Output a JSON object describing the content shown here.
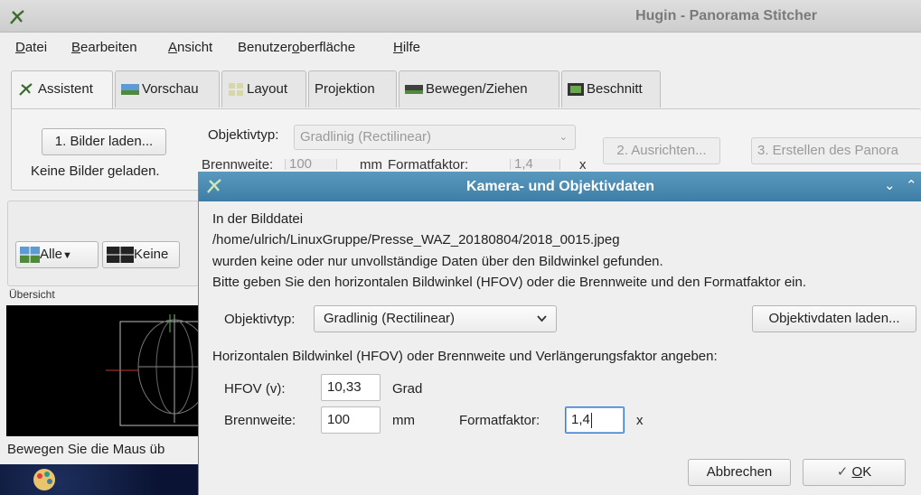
{
  "window": {
    "title": "Hugin - Panorama Stitcher"
  },
  "menubar": {
    "items": [
      {
        "pre": "",
        "u": "D",
        "post": "atei"
      },
      {
        "pre": "",
        "u": "B",
        "post": "earbeiten"
      },
      {
        "pre": "",
        "u": "A",
        "post": "nsicht"
      },
      {
        "pre": "Benutzer",
        "u": "o",
        "post": "berfläche"
      },
      {
        "pre": "",
        "u": "H",
        "post": "ilfe"
      }
    ]
  },
  "tabs": [
    {
      "label": "Assistent",
      "icon": "hugin-icon"
    },
    {
      "label": "Vorschau",
      "icon": "panorama-preview-icon"
    },
    {
      "label": "Layout",
      "icon": "layout-icon"
    },
    {
      "label": "Projektion",
      "icon": ""
    },
    {
      "label": "Bewegen/Ziehen",
      "icon": "move-drag-icon"
    },
    {
      "label": "Beschnitt",
      "icon": "crop-icon"
    }
  ],
  "assistant": {
    "load_images_button": "1. Bilder laden...",
    "no_images_label": "Keine Bilder geladen.",
    "lens_type_label": "Objektivtyp:",
    "lens_type_value": "Gradlinig (Rectilinear)",
    "focal_label": "Brennweite:",
    "focal_value": "100",
    "focal_unit": "mm",
    "crop_label": "Formatfaktor:",
    "crop_value": "1,4",
    "crop_unit": "x",
    "align_button": "2. Ausrichten...",
    "create_button": "3. Erstellen des Panora"
  },
  "left_panel": {
    "all_button": "Alle",
    "none_button": "Keine",
    "overview_label": "Übersicht",
    "status_text": "Bewegen Sie die Maus üb"
  },
  "dialog": {
    "title": "Kamera- und Objektivdaten",
    "message_lines": [
      "In der Bilddatei",
      "/home/ulrich/LinuxGruppe/Presse_WAZ_20180804/2018_0015.jpeg",
      "wurden keine oder nur unvollständige Daten über den Bildwinkel gefunden.",
      "Bitte geben Sie den horizontalen Bildwinkel (HFOV) oder die Brennweite und den Formatfaktor ein."
    ],
    "lens_type_label": "Objektivtyp:",
    "lens_type_value": "Gradlinig (Rectilinear)",
    "load_lens_button": "Objektivdaten laden...",
    "section_label": "Horizontalen Bildwinkel (HFOV) oder Brennweite und Verlängerungsfaktor angeben:",
    "hfov_label": "HFOV (v):",
    "hfov_value": "10,33",
    "hfov_unit": "Grad",
    "focal_label": "Brennweite:",
    "focal_value": "100",
    "focal_unit": "mm",
    "crop_label": "Formatfaktor:",
    "crop_value": "1,4",
    "crop_unit": "x",
    "cancel_button": "Abbrechen",
    "ok_button_u": "O",
    "ok_button_rest": "K"
  }
}
